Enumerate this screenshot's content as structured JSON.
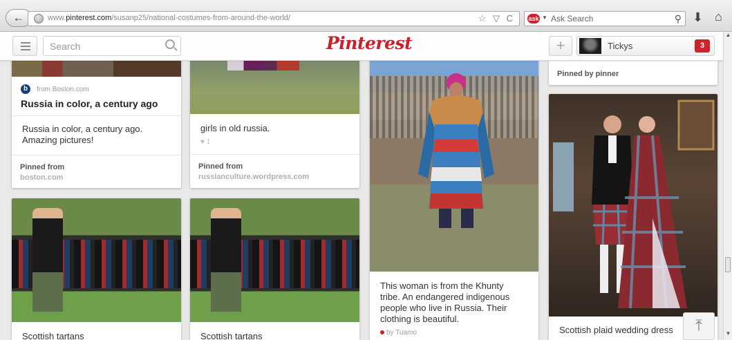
{
  "browser": {
    "url_prefix": "www.",
    "url_domain": "pinterest.com",
    "url_path": "/susanp25/national-costumes-from-around-the-world/",
    "url_controls": "☆ ▽ C",
    "search_placeholder": "Ask Search",
    "ask_logo": "ask",
    "back_glyph": "←",
    "download_glyph": "⬇",
    "home_glyph": "⌂"
  },
  "header": {
    "search_placeholder": "Search",
    "logo": "Pinterest",
    "add_glyph": "+",
    "username": "Tickys",
    "notifications": "3"
  },
  "pins": {
    "boston": {
      "source_label": "from Boston.com",
      "title": "Russia in color, a century ago",
      "description_1": "Russia in color, a century ago.",
      "description_2": "Amazing pictures!",
      "pinned_from_label": "Pinned from",
      "pinned_from_domain": "boston.com"
    },
    "girls": {
      "description": "girls in old russia.",
      "likes": "♥ 1",
      "pinned_from_label": "Pinned from",
      "pinned_from_domain": "russianculture.wordpress.com"
    },
    "khunty": {
      "description_1": "This woman is from the Khunty",
      "description_2": "tribe. An endangered indigenous",
      "description_3": "people who live in Russia. Their",
      "description_4": "clothing is beautiful.",
      "author": "by Tuamo"
    },
    "wedding": {
      "pinned_by": "Pinned by pinner",
      "description": "Scottish plaid wedding dress"
    },
    "tartans1": {
      "description": "Scottish tartans"
    },
    "tartans2": {
      "description": "Scottish tartans"
    }
  },
  "scroll_top_glyph": "⤒",
  "colors": {
    "brand": "#cb2027",
    "background": "#e9e9e9"
  }
}
